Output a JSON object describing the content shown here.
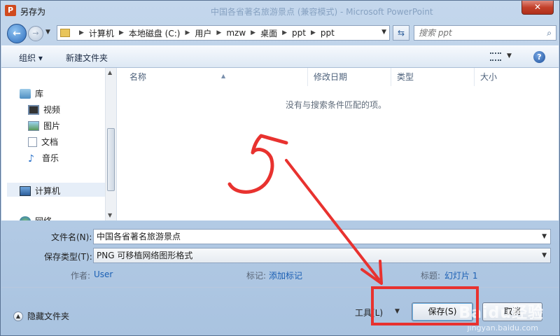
{
  "window": {
    "title": "另存为",
    "background_title": "中国各省著名旅游景点 (兼容模式) - Microsoft PowerPoint",
    "app_icon_letter": "P",
    "close_symbol": "✕"
  },
  "address_bar": {
    "breadcrumbs": [
      "计算机",
      "本地磁盘 (C:)",
      "用户",
      "mzw",
      "桌面",
      "ppt",
      "ppt"
    ],
    "search_placeholder": "搜索 ppt"
  },
  "toolbar": {
    "organize_label": "组织 ▾",
    "new_folder_label": "新建文件夹"
  },
  "nav_pane": {
    "items": [
      {
        "label": "库",
        "icon": "library-icon"
      },
      {
        "label": "视频",
        "icon": "video-icon"
      },
      {
        "label": "图片",
        "icon": "picture-icon"
      },
      {
        "label": "文档",
        "icon": "document-icon"
      },
      {
        "label": "音乐",
        "icon": "music-icon"
      },
      {
        "label": "计算机",
        "icon": "computer-icon"
      },
      {
        "label": "网络",
        "icon": "network-icon"
      }
    ]
  },
  "file_list": {
    "columns": [
      "名称",
      "修改日期",
      "类型",
      "大小"
    ],
    "empty_message": "没有与搜索条件匹配的项。"
  },
  "form": {
    "filename_label": "文件名(N):",
    "filename_value": "中国各省著名旅游景点",
    "type_label": "保存类型(T):",
    "type_value": "PNG 可移植网络图形格式",
    "author_label": "作者:",
    "author_value": "User",
    "tags_label": "标记:",
    "tags_value": "添加标记",
    "title_label": "标题:",
    "title_value": "幻灯片 1"
  },
  "footer": {
    "hide_folders_label": "隐藏文件夹",
    "tools_label": "工具(L)",
    "save_label": "保存(S)",
    "cancel_label": "取消"
  },
  "annotation": {
    "handwritten_text": "5",
    "color": "#e8322f"
  },
  "watermark": {
    "text": "Baidu经验",
    "sub": "jingyan.baidu.com"
  }
}
